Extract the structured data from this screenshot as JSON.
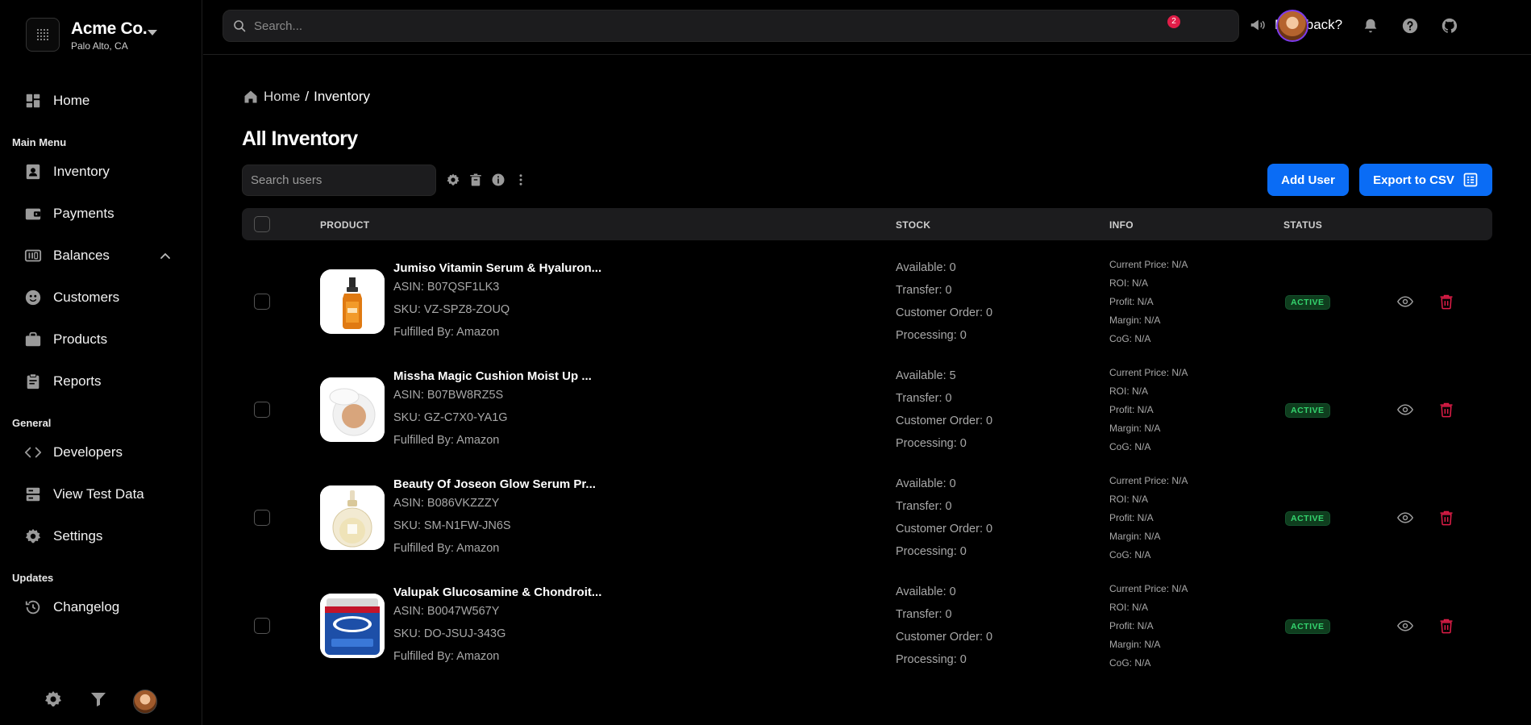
{
  "brand": {
    "name": "Acme Co.",
    "location": "Palo Alto, CA"
  },
  "sidebar": {
    "home": "Home",
    "sections": {
      "main": "Main Menu",
      "general": "General",
      "updates": "Updates"
    },
    "main_items": [
      "Inventory",
      "Payments",
      "Balances",
      "Customers",
      "Products",
      "Reports"
    ],
    "general_items": [
      "Developers",
      "View Test Data",
      "Settings"
    ],
    "updates_items": [
      "Changelog"
    ]
  },
  "topbar": {
    "search_placeholder": "Search...",
    "feedback_label": "Feedback?",
    "notification_count": "2"
  },
  "breadcrumb": {
    "home": "Home",
    "separator": "/",
    "current": "Inventory"
  },
  "page": {
    "title": "All Inventory",
    "search_placeholder": "Search users",
    "add_button": "Add User",
    "export_button": "Export to CSV"
  },
  "table": {
    "headers": {
      "product": "PRODUCT",
      "stock": "STOCK",
      "info": "INFO",
      "status": "STATUS"
    },
    "rows": [
      {
        "name": "Jumiso Vitamin Serum & Hyaluron...",
        "asin": "ASIN: B07QSF1LK3",
        "sku": "SKU: VZ-SPZ8-ZOUQ",
        "fulfilled": "Fulfilled By: Amazon",
        "available": "Available: 0",
        "transfer": "Transfer: 0",
        "customer_order": "Customer Order: 0",
        "processing": "Processing: 0",
        "current_price": "Current Price: N/A",
        "roi": "ROI: N/A",
        "profit": "Profit: N/A",
        "margin": "Margin: N/A",
        "cog": "CoG: N/A",
        "status": "ACTIVE",
        "thumb": "serum-bottle"
      },
      {
        "name": "Missha Magic Cushion Moist Up ...",
        "asin": "ASIN: B07BW8RZ5S",
        "sku": "SKU: GZ-C7X0-YA1G",
        "fulfilled": "Fulfilled By: Amazon",
        "available": "Available: 5",
        "transfer": "Transfer: 0",
        "customer_order": "Customer Order: 0",
        "processing": "Processing: 0",
        "current_price": "Current Price: N/A",
        "roi": "ROI: N/A",
        "profit": "Profit: N/A",
        "margin": "Margin: N/A",
        "cog": "CoG: N/A",
        "status": "ACTIVE",
        "thumb": "cushion-compact"
      },
      {
        "name": "Beauty Of Joseon Glow Serum Pr...",
        "asin": "ASIN: B086VKZZZY",
        "sku": "SKU: SM-N1FW-JN6S",
        "fulfilled": "Fulfilled By: Amazon",
        "available": "Available: 0",
        "transfer": "Transfer: 0",
        "customer_order": "Customer Order: 0",
        "processing": "Processing: 0",
        "current_price": "Current Price: N/A",
        "roi": "ROI: N/A",
        "profit": "Profit: N/A",
        "margin": "Margin: N/A",
        "cog": "CoG: N/A",
        "status": "ACTIVE",
        "thumb": "glow-serum"
      },
      {
        "name": "Valupak Glucosamine & Chondroit...",
        "asin": "ASIN: B0047W567Y",
        "sku": "SKU: DO-JSUJ-343G",
        "fulfilled": "Fulfilled By: Amazon",
        "available": "Available: 0",
        "transfer": "Transfer: 0",
        "customer_order": "Customer Order: 0",
        "processing": "Processing: 0",
        "current_price": "Current Price: N/A",
        "roi": "ROI: N/A",
        "profit": "Profit: N/A",
        "margin": "Margin: N/A",
        "cog": "CoG: N/A",
        "status": "ACTIVE",
        "thumb": "supplement-tub"
      }
    ]
  },
  "colors": {
    "accent": "#0a6cf5",
    "danger": "#e11d48",
    "status_active": "#34d46e",
    "background": "#000000",
    "surface": "#1c1c1e"
  }
}
